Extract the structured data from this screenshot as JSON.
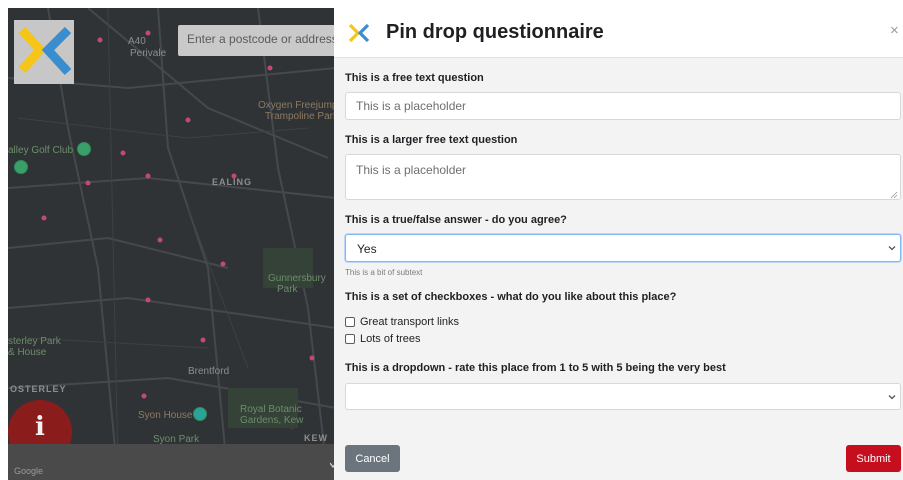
{
  "map": {
    "search_placeholder": "Enter a postcode or address t",
    "labels": {
      "perivale_a40": "A40",
      "perivale": "Perivale",
      "oxygen": "Oxygen Freejumping",
      "trampoline": "Trampoline Park",
      "golf": "alley Golf Club",
      "ealing": "EALING",
      "gunnersbury": "Gunnersbury",
      "gunnersbury_park": "Park",
      "osterley_park": "sterley Park",
      "osterley_house": "& House",
      "brentford": "Brentford",
      "osterley": "OSTERLEY",
      "syon_house": "Syon House",
      "royal_botanic": "Royal Botanic",
      "gardens_kew": "Gardens, Kew",
      "kew": "KEW",
      "syon_park": "Syon Park",
      "google": "Google"
    },
    "info_symbol": "i"
  },
  "modal": {
    "title": "Pin drop questionnaire",
    "close_symbol": "×",
    "questions": {
      "q1_label": "This is a free text question",
      "q1_placeholder": "This is a placeholder",
      "q2_label": "This is a larger free text question",
      "q2_placeholder": "This is a placeholder",
      "q3_label": "This is a true/false answer - do you agree?",
      "q3_value": "Yes",
      "q3_subtext": "This is a bit of subtext",
      "q4_label": "This is a set of checkboxes - what do you like about this place?",
      "q4_options": [
        "Great transport links",
        "Lots of trees"
      ],
      "q5_label": "This is a dropdown - rate this place from 1 to 5 with 5 being the very best",
      "q5_value": ""
    },
    "buttons": {
      "cancel": "Cancel",
      "submit": "Submit"
    }
  },
  "colors": {
    "submit": "#c50f1f",
    "cancel": "#6c757d",
    "logo_yellow": "#f5c518",
    "logo_blue": "#3a8ecf",
    "map_bg": "#2f3336"
  },
  "icons": [
    "brand-logo-icon",
    "close-icon",
    "chevron-down-icon",
    "info-icon",
    "map-pin-icon",
    "resize-grip-icon"
  ]
}
